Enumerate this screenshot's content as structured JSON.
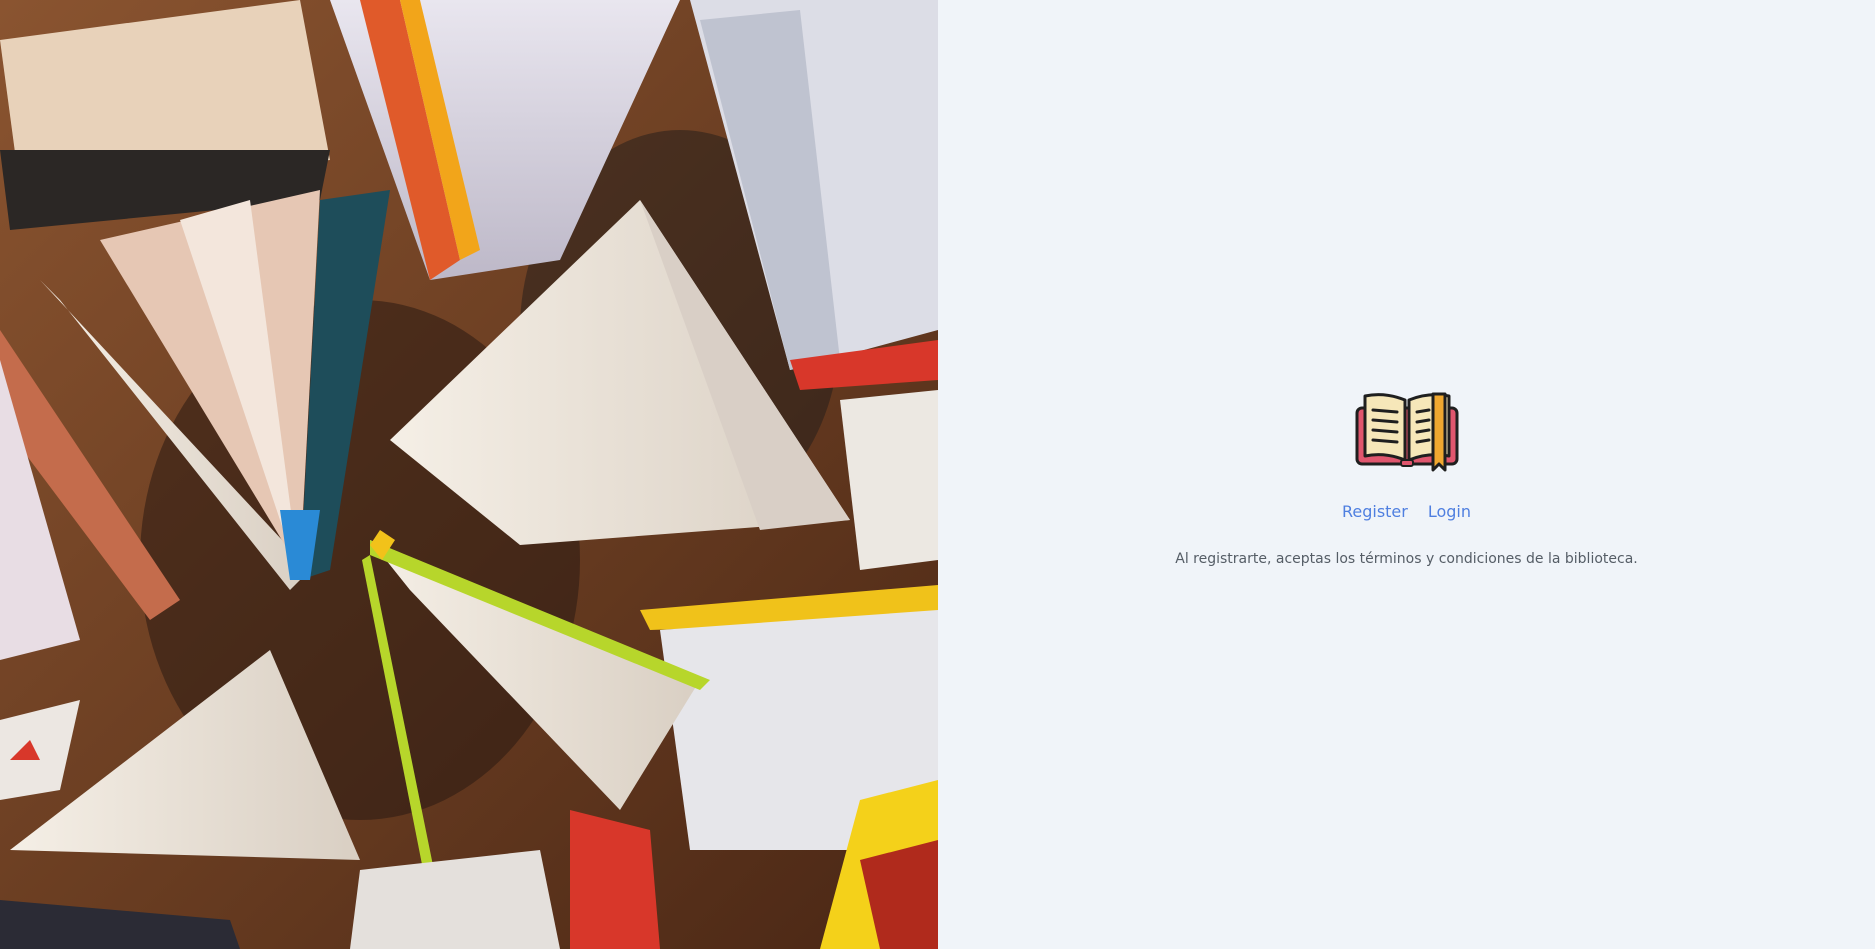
{
  "hero": {
    "image": "books-photo",
    "colors": {
      "wood": "#6b3e22",
      "page": "#efe6dc",
      "accent_red": "#d8372a",
      "accent_yellow": "#f2c21a",
      "accent_green": "#b7d62b"
    }
  },
  "logo": {
    "icon": "open-book-icon",
    "colors": {
      "cover": "#e0566e",
      "pages": "#f6e7b9",
      "bookmark": "#f0a830",
      "outline": "#1f1f1f"
    }
  },
  "nav": {
    "register_label": "Register",
    "login_label": "Login",
    "link_color": "#4f7fe0"
  },
  "terms_text": "Al registrarte, aceptas los términos y condiciones de la biblioteca."
}
